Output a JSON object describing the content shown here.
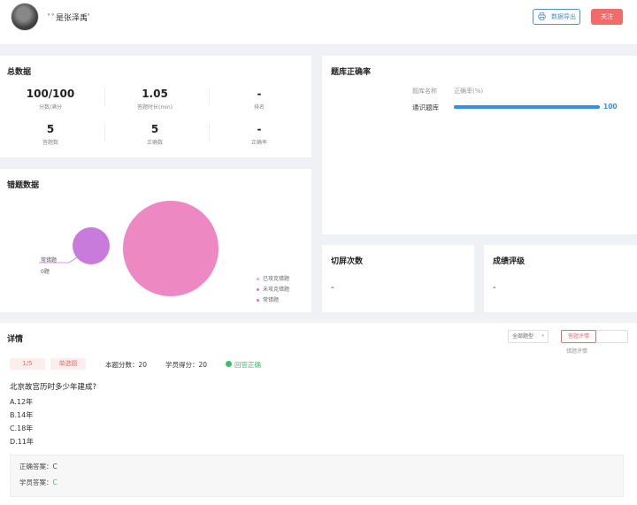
{
  "header": {
    "username": "ﾟﾟ是张泽禹ﾟ",
    "export_label": "数据导出",
    "follow_label": "关注"
  },
  "summary": {
    "title": "总数据",
    "stats": [
      {
        "value": "100/100",
        "label": "分数/满分"
      },
      {
        "value": "1.05",
        "label": "答题时长(min)"
      },
      {
        "value": "-",
        "label": "排名"
      },
      {
        "value": "5",
        "label": "答题数"
      },
      {
        "value": "5",
        "label": "正确数"
      },
      {
        "value": "-",
        "label": "正确率"
      }
    ]
  },
  "bank": {
    "title": "题库正确率",
    "col_name": "题库名称",
    "col_rate": "正确率(%)",
    "rows": [
      {
        "name": "通识题库",
        "rate": 100,
        "rate_label": "100"
      }
    ],
    "bar_color": "#3a8ee6"
  },
  "errors": {
    "title": "错题数据",
    "callout_name": "常错题",
    "callout_value": "0题",
    "legend": [
      {
        "label": "已攻克错题",
        "color": "#f3a6cf"
      },
      {
        "label": "未攻克错题",
        "color": "#c97bdc"
      },
      {
        "label": "常错题",
        "color": "#d86fcf"
      }
    ],
    "bubble_colors": {
      "large": "#ed88c3",
      "small": "#c97bdc"
    }
  },
  "switch_screen": {
    "title": "切屏次数",
    "value": "-"
  },
  "grade": {
    "title": "成绩评级",
    "value": "-"
  },
  "detail": {
    "title": "详情",
    "type_select": "全部题型",
    "wrong_review": "答题评情",
    "wrong_review_sub": "错题评情",
    "question": {
      "index": "1/5",
      "type": "单选题",
      "score_text": "本题分数：20",
      "student_score_text": "学员得分：20",
      "status": "回答正确",
      "stem": "北京故宫历时多少年建成?",
      "options": [
        "A.12年",
        "B.14年",
        "C.18年",
        "D.11年"
      ],
      "correct_label": "正确答案：",
      "correct_value": "C",
      "student_label": "学员答案：",
      "student_value": "C"
    }
  },
  "colors": {
    "accent": "#4a90d9",
    "danger": "#f26b6b",
    "success": "#3cbf6b"
  }
}
